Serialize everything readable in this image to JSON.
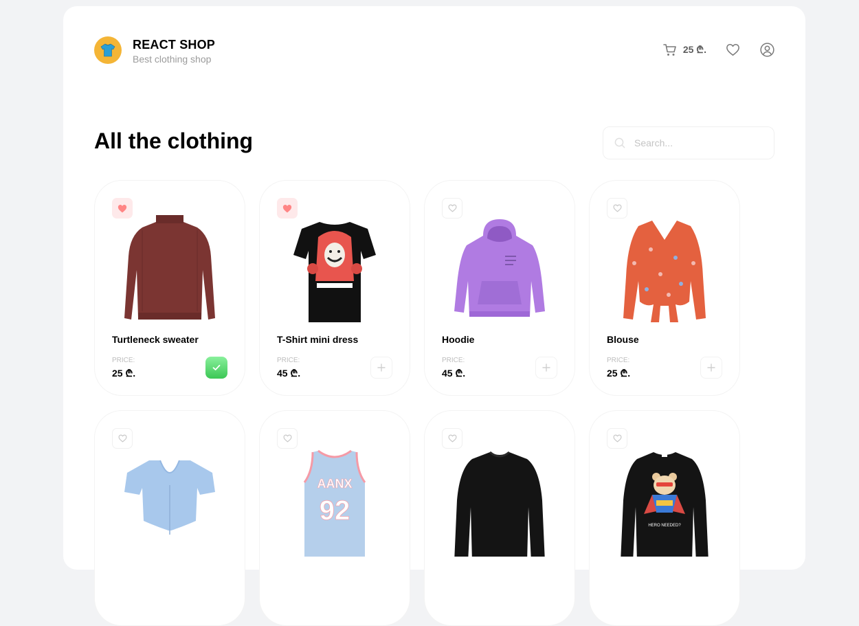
{
  "brand": {
    "name": "REACT SHOP",
    "tagline": "Best clothing shop"
  },
  "header": {
    "cart_total": "25 ₾."
  },
  "main": {
    "title": "All the clothing"
  },
  "search": {
    "placeholder": "Search..."
  },
  "colors": {
    "accent_yellow": "#f4b536",
    "fav_active": "#ff8585",
    "added_green": "#3cc755"
  },
  "products": [
    {
      "name": "Turtleneck sweater",
      "price_label": "PRICE:",
      "price": "25 ₾.",
      "favorite": true,
      "in_cart": true
    },
    {
      "name": "T-Shirt mini dress",
      "price_label": "PRICE:",
      "price": "45 ₾.",
      "favorite": true,
      "in_cart": false
    },
    {
      "name": "Hoodie",
      "price_label": "PRICE:",
      "price": "45 ₾.",
      "favorite": false,
      "in_cart": false
    },
    {
      "name": "Blouse",
      "price_label": "PRICE:",
      "price": "25 ₾.",
      "favorite": false,
      "in_cart": false
    },
    {
      "favorite": false
    },
    {
      "favorite": false
    },
    {
      "favorite": false
    },
    {
      "favorite": false
    }
  ]
}
